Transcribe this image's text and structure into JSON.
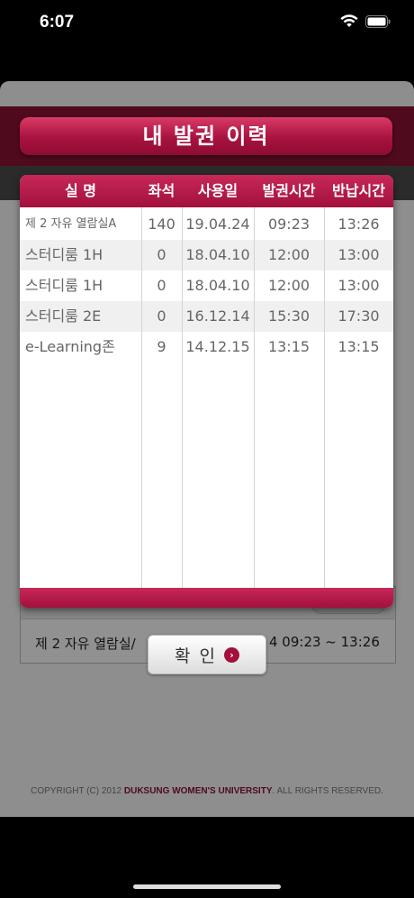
{
  "status_bar": {
    "time": "6:07"
  },
  "dialog": {
    "title": "내 발권 이력",
    "columns": [
      "실 명",
      "좌석",
      "사용일",
      "발권시간",
      "반납시간"
    ],
    "rows": [
      {
        "room": "제 2 자유   열람실A",
        "seat": "140",
        "date": "19.04.24",
        "issued": "09:23",
        "returned": "13:26"
      },
      {
        "room": "스터디룸 1H",
        "seat": "0",
        "date": "18.04.10",
        "issued": "12:00",
        "returned": "13:00"
      },
      {
        "room": "스터디룸 1H",
        "seat": "0",
        "date": "18.04.10",
        "issued": "12:00",
        "returned": "13:00"
      },
      {
        "room": "스터디룸 2E",
        "seat": "0",
        "date": "16.12.14",
        "issued": "15:30",
        "returned": "17:30"
      },
      {
        "room": "e-Learning존",
        "seat": "9",
        "date": "14.12.15",
        "issued": "13:15",
        "returned": "13:15"
      }
    ],
    "confirm_label": "확 인"
  },
  "background": {
    "current_row_left": "제 2 자유   열람실/",
    "current_row_right": "4 09:23 ~ 13:26",
    "footer_prefix": "COPYRIGHT (C) 2012 ",
    "footer_brand": "DUKSUNG WOMEN'S UNIVERSITY",
    "footer_suffix": ". ALL RIGHTS RESERVED."
  },
  "colors": {
    "accent": "#a3103d",
    "header_dark": "#8a1235"
  }
}
